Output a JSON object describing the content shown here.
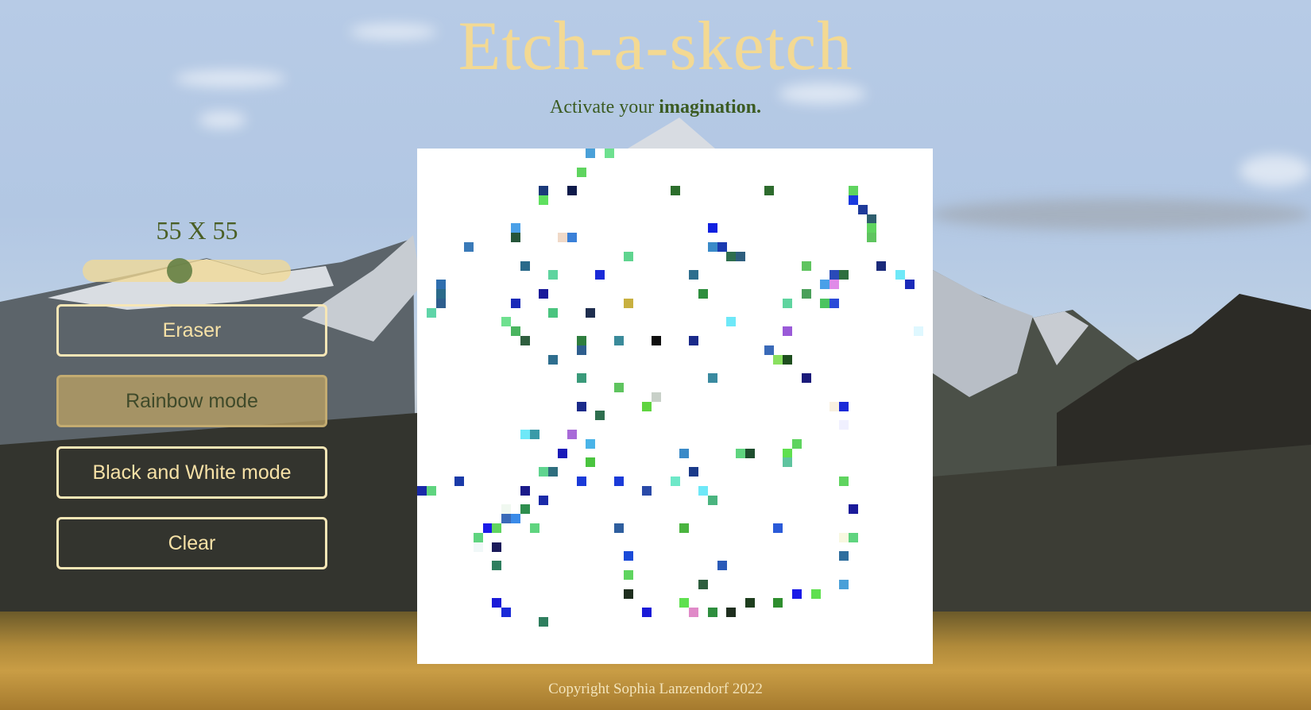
{
  "header": {
    "title": "Etch-a-sketch",
    "subtitle_prefix": "Activate your ",
    "subtitle_emphasis": "imagination."
  },
  "controls": {
    "grid_size_label": "55 X 55",
    "grid_size": 55,
    "slider_value_fraction": 0.46,
    "buttons": [
      {
        "label": "Eraser",
        "active": false
      },
      {
        "label": "Rainbow mode",
        "active": true
      },
      {
        "label": "Black and White mode",
        "active": false
      },
      {
        "label": "Clear",
        "active": false
      }
    ]
  },
  "board": {
    "grid": 55,
    "background": "#ffffff",
    "painted_cells": [
      [
        18,
        0,
        "#4aa0d8"
      ],
      [
        20,
        0,
        "#6ee08f"
      ],
      [
        17,
        2,
        "#5fd45f"
      ],
      [
        13,
        4,
        "#1b3a7a"
      ],
      [
        16,
        4,
        "#0e1a4a"
      ],
      [
        27,
        4,
        "#2c6e2c"
      ],
      [
        37,
        4,
        "#2d6b2d"
      ],
      [
        46,
        4,
        "#5fd45f"
      ],
      [
        13,
        5,
        "#5fe05f"
      ],
      [
        46,
        5,
        "#1a3adf"
      ],
      [
        47,
        6,
        "#1e3a9a"
      ],
      [
        48,
        7,
        "#2e5e6e"
      ],
      [
        48,
        8,
        "#5fd45f"
      ],
      [
        10,
        8,
        "#4aa0e8"
      ],
      [
        31,
        8,
        "#1020e0"
      ],
      [
        10,
        9,
        "#25553a"
      ],
      [
        15,
        9,
        "#f0d9c8"
      ],
      [
        16,
        9,
        "#3a80d8"
      ],
      [
        48,
        9,
        "#5fc45f"
      ],
      [
        5,
        10,
        "#3a7ab8"
      ],
      [
        31,
        10,
        "#3a8ac8"
      ],
      [
        32,
        10,
        "#1a3ab0"
      ],
      [
        33,
        11,
        "#2e6e4e"
      ],
      [
        34,
        11,
        "#2e5e7e"
      ],
      [
        22,
        11,
        "#5fd48f"
      ],
      [
        11,
        12,
        "#2a6a8a"
      ],
      [
        41,
        12,
        "#5fc45f"
      ],
      [
        49,
        12,
        "#1a2a7a"
      ],
      [
        14,
        13,
        "#5fd49f"
      ],
      [
        19,
        13,
        "#1a2ad8"
      ],
      [
        29,
        13,
        "#2e6e8e"
      ],
      [
        44,
        13,
        "#2a4ab8"
      ],
      [
        45,
        13,
        "#2e6e3e"
      ],
      [
        51,
        13,
        "#6ee8f8"
      ],
      [
        2,
        14,
        "#2e6eae"
      ],
      [
        43,
        14,
        "#4aa0e8"
      ],
      [
        44,
        14,
        "#e08ae8"
      ],
      [
        52,
        14,
        "#1a2ab8"
      ],
      [
        2,
        15,
        "#2a6a8a"
      ],
      [
        13,
        15,
        "#1a1a9a"
      ],
      [
        30,
        15,
        "#2e8e3e"
      ],
      [
        41,
        15,
        "#4aa05a"
      ],
      [
        2,
        16,
        "#2e5e8e"
      ],
      [
        10,
        16,
        "#1a2ab8"
      ],
      [
        22,
        16,
        "#c8b040"
      ],
      [
        39,
        16,
        "#5fd49f"
      ],
      [
        43,
        16,
        "#4ac45f"
      ],
      [
        44,
        16,
        "#2a4ad8"
      ],
      [
        1,
        17,
        "#5fd4a8"
      ],
      [
        14,
        17,
        "#4ac47f"
      ],
      [
        18,
        17,
        "#1e2e4e"
      ],
      [
        9,
        18,
        "#6ee08f"
      ],
      [
        33,
        18,
        "#6ee8f8"
      ],
      [
        10,
        19,
        "#4ab45f"
      ],
      [
        39,
        19,
        "#9a5ad8"
      ],
      [
        53,
        19,
        "#dff8ff"
      ],
      [
        11,
        20,
        "#2e5e3e"
      ],
      [
        17,
        20,
        "#2e7e3e"
      ],
      [
        21,
        20,
        "#3a8a9a"
      ],
      [
        25,
        20,
        "#0e0e0e"
      ],
      [
        29,
        20,
        "#1a2a8a"
      ],
      [
        17,
        21,
        "#2e5e8e"
      ],
      [
        37,
        21,
        "#3a6ab8"
      ],
      [
        14,
        22,
        "#2e6e8e"
      ],
      [
        38,
        22,
        "#8ae05f"
      ],
      [
        39,
        22,
        "#1e4e1e"
      ],
      [
        17,
        24,
        "#3a9a7a"
      ],
      [
        31,
        24,
        "#3a8aa0"
      ],
      [
        41,
        24,
        "#1a1a7a"
      ],
      [
        21,
        25,
        "#5fc45f"
      ],
      [
        25,
        26,
        "#c8d0c8"
      ],
      [
        17,
        27,
        "#1a2a8a"
      ],
      [
        24,
        27,
        "#5fd43f"
      ],
      [
        44,
        27,
        "#f8f0e0"
      ],
      [
        45,
        27,
        "#1a2ad8"
      ],
      [
        19,
        28,
        "#2e6e4e"
      ],
      [
        45,
        29,
        "#f0f0ff"
      ],
      [
        11,
        30,
        "#6ee8f8"
      ],
      [
        12,
        30,
        "#3a9aa8"
      ],
      [
        16,
        30,
        "#a86ad8"
      ],
      [
        40,
        31,
        "#5fd45f"
      ],
      [
        18,
        31,
        "#4ab4e8"
      ],
      [
        15,
        32,
        "#1a1ab8"
      ],
      [
        28,
        32,
        "#3a8ac8"
      ],
      [
        34,
        32,
        "#5fd47f"
      ],
      [
        35,
        32,
        "#1e4e2e"
      ],
      [
        39,
        32,
        "#5fe04f"
      ],
      [
        18,
        33,
        "#4ac43f"
      ],
      [
        39,
        33,
        "#5fc49f"
      ],
      [
        13,
        34,
        "#5fd48f"
      ],
      [
        14,
        34,
        "#2e6e7e"
      ],
      [
        29,
        34,
        "#1a3a8a"
      ],
      [
        4,
        35,
        "#1a3aa8"
      ],
      [
        17,
        35,
        "#1a3ad8"
      ],
      [
        21,
        35,
        "#1a3ad8"
      ],
      [
        27,
        35,
        "#6ee8c8"
      ],
      [
        45,
        35,
        "#5fd45f"
      ],
      [
        0,
        36,
        "#1a2aa8"
      ],
      [
        1,
        36,
        "#5fd47f"
      ],
      [
        11,
        36,
        "#1a1a8a"
      ],
      [
        24,
        36,
        "#2a4aa8"
      ],
      [
        30,
        36,
        "#6ee8f8"
      ],
      [
        13,
        37,
        "#1a2aa8"
      ],
      [
        31,
        37,
        "#4ab47f"
      ],
      [
        9,
        38,
        "#f0f8f0"
      ],
      [
        11,
        38,
        "#2e8e4e"
      ],
      [
        46,
        38,
        "#1a1a9a"
      ],
      [
        9,
        39,
        "#3a6ab8"
      ],
      [
        10,
        39,
        "#3a8ae8"
      ],
      [
        7,
        40,
        "#1a1ae8"
      ],
      [
        8,
        40,
        "#5fd45f"
      ],
      [
        12,
        40,
        "#5fd47f"
      ],
      [
        21,
        40,
        "#2e5e9e"
      ],
      [
        28,
        40,
        "#4ab43f"
      ],
      [
        38,
        40,
        "#2a5ad8"
      ],
      [
        6,
        41,
        "#5fd47f"
      ],
      [
        45,
        41,
        "#f8f8e0"
      ],
      [
        46,
        41,
        "#5fd47f"
      ],
      [
        6,
        42,
        "#f0f8f8"
      ],
      [
        8,
        42,
        "#1a1a5a"
      ],
      [
        22,
        43,
        "#1a4ad8"
      ],
      [
        45,
        43,
        "#2e6e9e"
      ],
      [
        8,
        44,
        "#2e7e5e"
      ],
      [
        32,
        44,
        "#2a5ab8"
      ],
      [
        22,
        45,
        "#5fd45f"
      ],
      [
        30,
        46,
        "#2e5e3e"
      ],
      [
        45,
        46,
        "#4aa0d8"
      ],
      [
        22,
        47,
        "#1e2e1e"
      ],
      [
        40,
        47,
        "#1a1ae8"
      ],
      [
        42,
        47,
        "#5fe04f"
      ],
      [
        8,
        48,
        "#1a1ad8"
      ],
      [
        28,
        48,
        "#5fe04f"
      ],
      [
        35,
        48,
        "#1e3e1e"
      ],
      [
        38,
        48,
        "#2e8e2e"
      ],
      [
        9,
        49,
        "#1a2ad8"
      ],
      [
        24,
        49,
        "#1a1ad8"
      ],
      [
        29,
        49,
        "#e08ac8"
      ],
      [
        31,
        49,
        "#2e8e3e"
      ],
      [
        33,
        49,
        "#1e2e1e"
      ],
      [
        13,
        50,
        "#2e7e5e"
      ]
    ]
  },
  "footer": {
    "copyright": "Copyright Sophia Lanzendorf 2022"
  }
}
